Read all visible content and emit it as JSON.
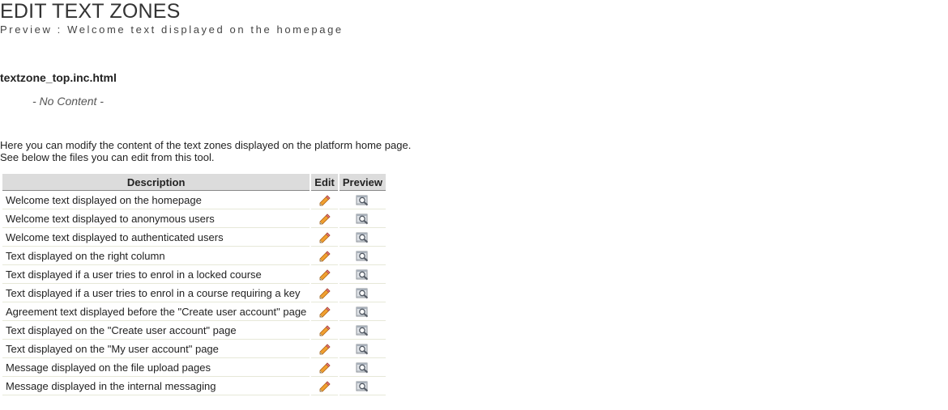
{
  "header": {
    "title": "EDIT TEXT ZONES",
    "subtitle": "Preview : Welcome text displayed on the homepage"
  },
  "preview": {
    "file_name": "textzone_top.inc.html",
    "content": "- No Content -"
  },
  "intro": {
    "line1": "Here you can modify the content of the text zones displayed on the platform home page.",
    "line2": "See below the files you can edit from this tool."
  },
  "table": {
    "columns": [
      "Description",
      "Edit",
      "Preview"
    ],
    "rows": [
      {
        "description": "Welcome text displayed on the homepage"
      },
      {
        "description": "Welcome text displayed to anonymous users"
      },
      {
        "description": "Welcome text displayed to authenticated users"
      },
      {
        "description": "Text displayed on the right column"
      },
      {
        "description": "Text displayed if a user tries to enrol in a locked course"
      },
      {
        "description": "Text displayed if a user tries to enrol in a course requiring a key"
      },
      {
        "description": "Agreement text displayed before the \"Create user account\" page"
      },
      {
        "description": "Text displayed on the \"Create user account\" page"
      },
      {
        "description": "Text displayed on the \"My user account\" page"
      },
      {
        "description": "Message displayed on the file upload pages"
      },
      {
        "description": "Message displayed in the internal messaging"
      }
    ]
  },
  "icons": {
    "edit": "pencil-icon",
    "preview": "magnifier-preview-icon"
  }
}
